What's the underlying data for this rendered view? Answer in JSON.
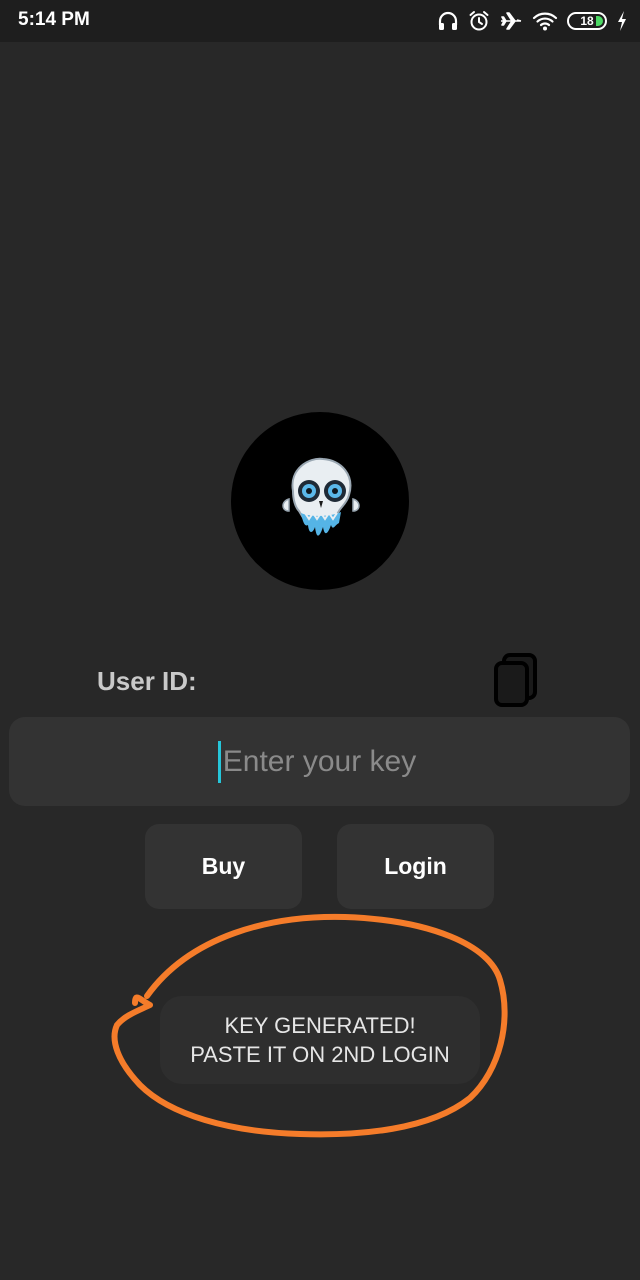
{
  "status_bar": {
    "time": "5:14 PM",
    "battery_level": "18",
    "icons": [
      "headphones-icon",
      "alarm-icon",
      "airplane-icon",
      "wifi-icon",
      "battery-icon",
      "charging-icon"
    ]
  },
  "login": {
    "avatar_icon": "skull-logo",
    "user_id_label": "User ID:",
    "copy_icon": "copy-icon",
    "key_placeholder": "Enter your key",
    "key_value": "",
    "buy_label": "Buy",
    "login_label": "Login"
  },
  "toast": {
    "line1": "KEY GENERATED!",
    "line2": "PASTE IT ON 2ND LOGIN"
  },
  "colors": {
    "background": "#282828",
    "surface": "#333333",
    "caret": "#26c6da",
    "annotation": "#f57c2a",
    "battery_fill": "#4cd964"
  }
}
